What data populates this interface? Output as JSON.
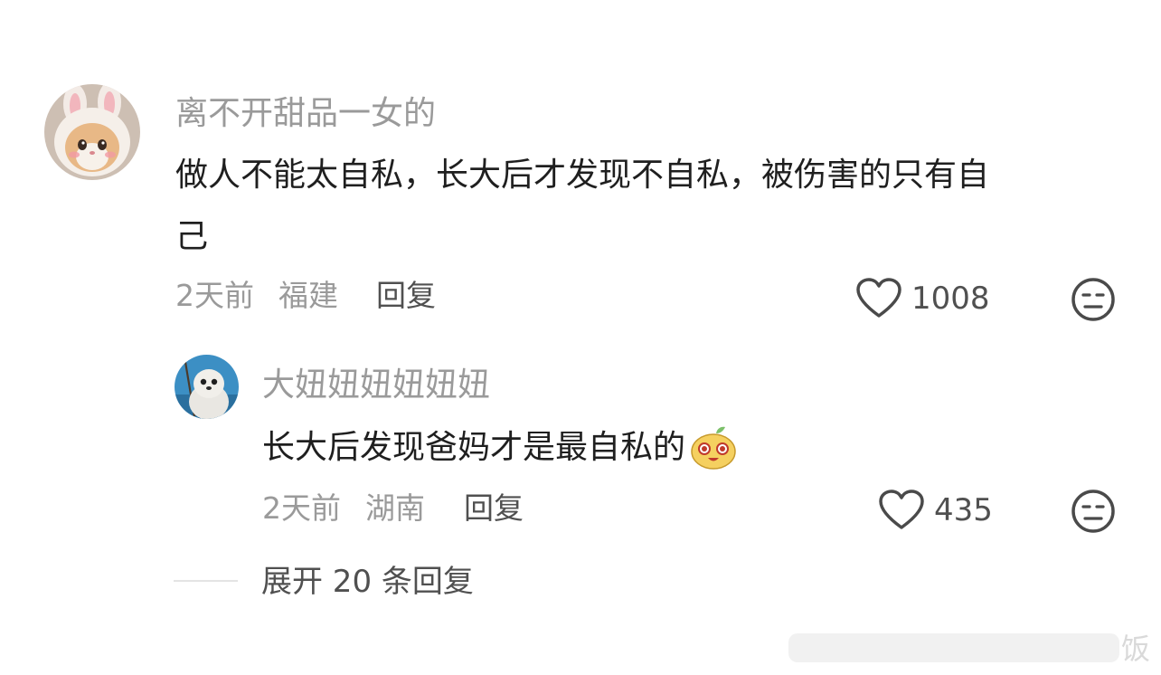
{
  "comment": {
    "username": "离不开甜品一女的",
    "text_line1": "做人不能太自私，长大后才发现不自私，被伤害的只有自",
    "text_line2": "己",
    "date": "2天前",
    "location": "福建",
    "reply_label": "回复",
    "like_count": "1008",
    "avatar_icon": "cat-bunny-avatar"
  },
  "reply": {
    "username": "大妞妞妞妞妞妞",
    "text": "长大后发现爸妈才是最自私的",
    "emoji_icon": "happy-sprout-emoji",
    "date": "2天前",
    "location": "湖南",
    "reply_label": "回复",
    "like_count": "435",
    "avatar_icon": "seal-avatar"
  },
  "expand": {
    "label": "展开 20 条回复"
  },
  "watermark": {
    "text": "饭"
  },
  "colors": {
    "meta_gray": "#9a9a9a",
    "text_dark": "#1f1f1f",
    "action_gray": "#505050"
  }
}
